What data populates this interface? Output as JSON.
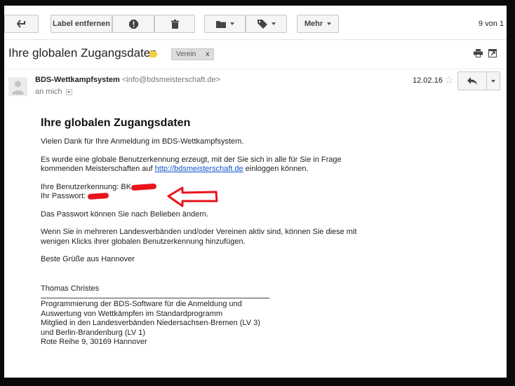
{
  "toolbar": {
    "back_icon": "back-arrow-icon",
    "remove_label": "Label entfernen",
    "spam_icon": "report-spam-icon",
    "delete_icon": "trash-icon",
    "move_icon": "folder-icon",
    "labels_icon": "label-tag-icon",
    "more_label": "Mehr",
    "pager": "9 von 1"
  },
  "email": {
    "subject": "Ihre globalen Zugangsdaten",
    "label_chip": "Verein",
    "label_chip_close": "x",
    "sender_name": "BDS-Wettkampfsystem",
    "sender_email": "<info@bdsmeisterschaft.de>",
    "recipient": "an mich",
    "date": "12.02.16",
    "star": "☆"
  },
  "body": {
    "heading": "Ihre globalen Zugangsdaten",
    "p1": "Vielen Dank für Ihre Anmeldung im BDS-Wettkampfsystem.",
    "p2_before": "Es wurde eine globale Benutzerkennung erzeugt, mit der Sie sich in alle für Sie in Frage kommenden Meisterschaften auf ",
    "p2_link": "http://bdsmeisterschaft.de",
    "p2_after": " einloggen können.",
    "username_label": "Ihre Benutzerkennung: BK",
    "password_label": "Ihr Passwort: ",
    "p4": "Das Passwort können Sie nach Belieben ändern.",
    "p5": "Wenn Sie in mehreren Landesverbänden und/oder Vereinen aktiv sind, können Sie diese mit wenigen Klicks ihrer globalen Benutzerkennung hinzufügen.",
    "greeting": "Beste Grüße aus Hannover",
    "signature_name": "Thomas Christes",
    "footer": [
      "Programmierung der BDS-Software für die Anmeldung und",
      "Auswertung von Wettkämpfen im Standardprogramm",
      "Mitglied in den Landesverbänden Niedersachsen-Bremen (LV 3)",
      "und Berlin-Brandenburg (LV 1)",
      "Rote Reihe 9, 30169 Hannover"
    ]
  },
  "colors": {
    "annotation_arrow": "#e8151c",
    "link": "#1155cc",
    "label_tag": "#f2cd45"
  }
}
